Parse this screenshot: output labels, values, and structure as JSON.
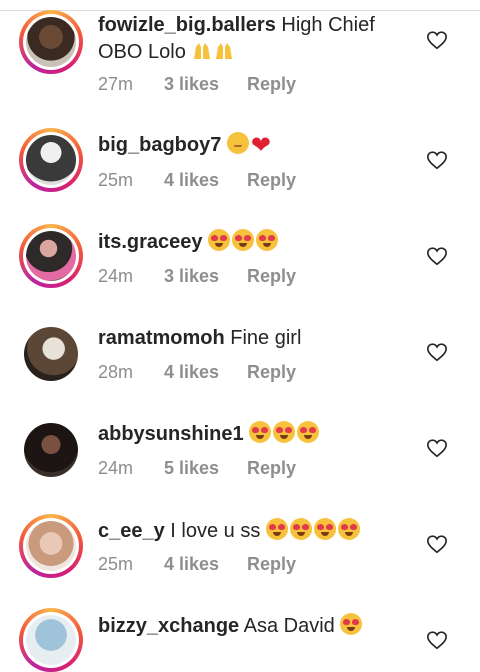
{
  "comments": [
    {
      "username": "fowizle_big.ballers",
      "text": " High Chief OBO Lolo",
      "time": "27m",
      "likes": "3 likes",
      "reply": "Reply"
    },
    {
      "username": "big_bagboy7",
      "text": "",
      "time": "25m",
      "likes": "4 likes",
      "reply": "Reply"
    },
    {
      "username": "its.graceey",
      "text": "",
      "time": "24m",
      "likes": "3 likes",
      "reply": "Reply"
    },
    {
      "username": "ramatmomoh",
      "text": " Fine girl",
      "time": "28m",
      "likes": "4 likes",
      "reply": "Reply"
    },
    {
      "username": "abbysunshine1",
      "text": "",
      "time": "24m",
      "likes": "5 likes",
      "reply": "Reply"
    },
    {
      "username": "c_ee_y",
      "text": " I love u ss",
      "time": "25m",
      "likes": "4 likes",
      "reply": "Reply"
    },
    {
      "username": "bizzy_xchange",
      "text": " Asa David",
      "time": "",
      "likes": "",
      "reply": ""
    }
  ],
  "colors": {
    "ring_start": "#f9b54a",
    "ring_end": "#b824a0",
    "meta": "#8e8e8e",
    "text": "#262626"
  },
  "icons": {
    "like": "heart-outline-icon"
  }
}
